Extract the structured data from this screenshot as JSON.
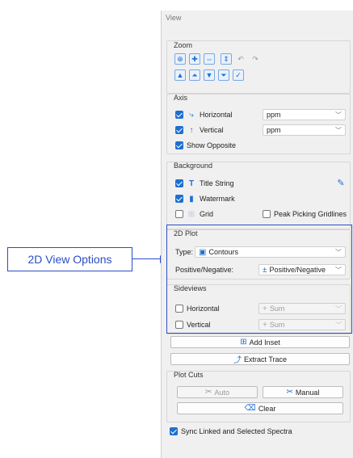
{
  "panel": {
    "title": "View"
  },
  "zoom": {
    "legend": "Zoom",
    "row1": [
      {
        "name": "zoom-in-icon",
        "glyph": "⊕"
      },
      {
        "name": "zoom-all-icon",
        "glyph": "✚"
      },
      {
        "name": "zoom-horizontal-icon",
        "glyph": "⇔"
      },
      {
        "name": "zoom-vertical-icon",
        "glyph": "⇕"
      },
      {
        "name": "undo-zoom-icon",
        "glyph": "↶"
      },
      {
        "name": "redo-zoom-icon",
        "glyph": "↷"
      }
    ],
    "row2": [
      {
        "name": "scale-up-icon",
        "glyph": "︿"
      },
      {
        "name": "scale-up-fast-icon",
        "glyph": "︽"
      },
      {
        "name": "scale-down-icon",
        "glyph": "﹀"
      },
      {
        "name": "scale-down-fast-icon",
        "glyph": "︾"
      },
      {
        "name": "auto-scale-icon",
        "glyph": "✓"
      }
    ]
  },
  "axis": {
    "legend": "Axis",
    "horizontal_label": "Horizontal",
    "horizontal_unit": "ppm",
    "vertical_label": "Vertical",
    "vertical_unit": "ppm",
    "show_opposite_label": "Show Opposite"
  },
  "background": {
    "legend": "Background",
    "title_string_label": "Title String",
    "watermark_label": "Watermark",
    "grid_label": "Grid",
    "peak_picking_label": "Peak Picking Gridlines"
  },
  "plot2d": {
    "legend": "2D Plot",
    "type_label": "Type:",
    "type_value": "Contours",
    "posneg_label": "Positive/Negative:",
    "posneg_value": "Positive/Negative"
  },
  "sideviews": {
    "legend": "Sideviews",
    "horizontal_label": "Horizontal",
    "horizontal_value": "Sum",
    "vertical_label": "Vertical",
    "vertical_value": "Sum"
  },
  "buttons": {
    "add_inset": "Add Inset",
    "extract_trace": "Extract Trace"
  },
  "plot_cuts": {
    "legend": "Plot Cuts",
    "auto": "Auto",
    "manual": "Manual",
    "clear": "Clear"
  },
  "sync": {
    "label": "Sync Linked and Selected Spectra"
  },
  "callout": {
    "label": "2D View Options"
  },
  "colors": {
    "accent": "#1f6fd0",
    "highlight": "#2a4ec7"
  }
}
